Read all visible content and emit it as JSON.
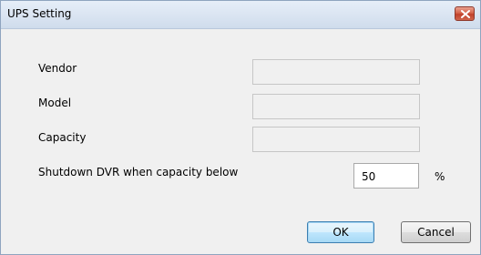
{
  "window": {
    "title": "UPS Setting"
  },
  "form": {
    "vendor_label": "Vendor",
    "vendor_value": "",
    "model_label": "Model",
    "model_value": "",
    "capacity_label": "Capacity",
    "capacity_value": "",
    "shutdown_label": "Shutdown DVR when capacity below",
    "shutdown_value": "50",
    "shutdown_unit": "%"
  },
  "buttons": {
    "ok_label": "OK",
    "cancel_label": "Cancel"
  },
  "icons": {
    "close": "close-icon"
  },
  "colors": {
    "close_button": "#c8503a",
    "ok_border": "#3c7fb1",
    "dialog_bg": "#f0f0f0"
  }
}
